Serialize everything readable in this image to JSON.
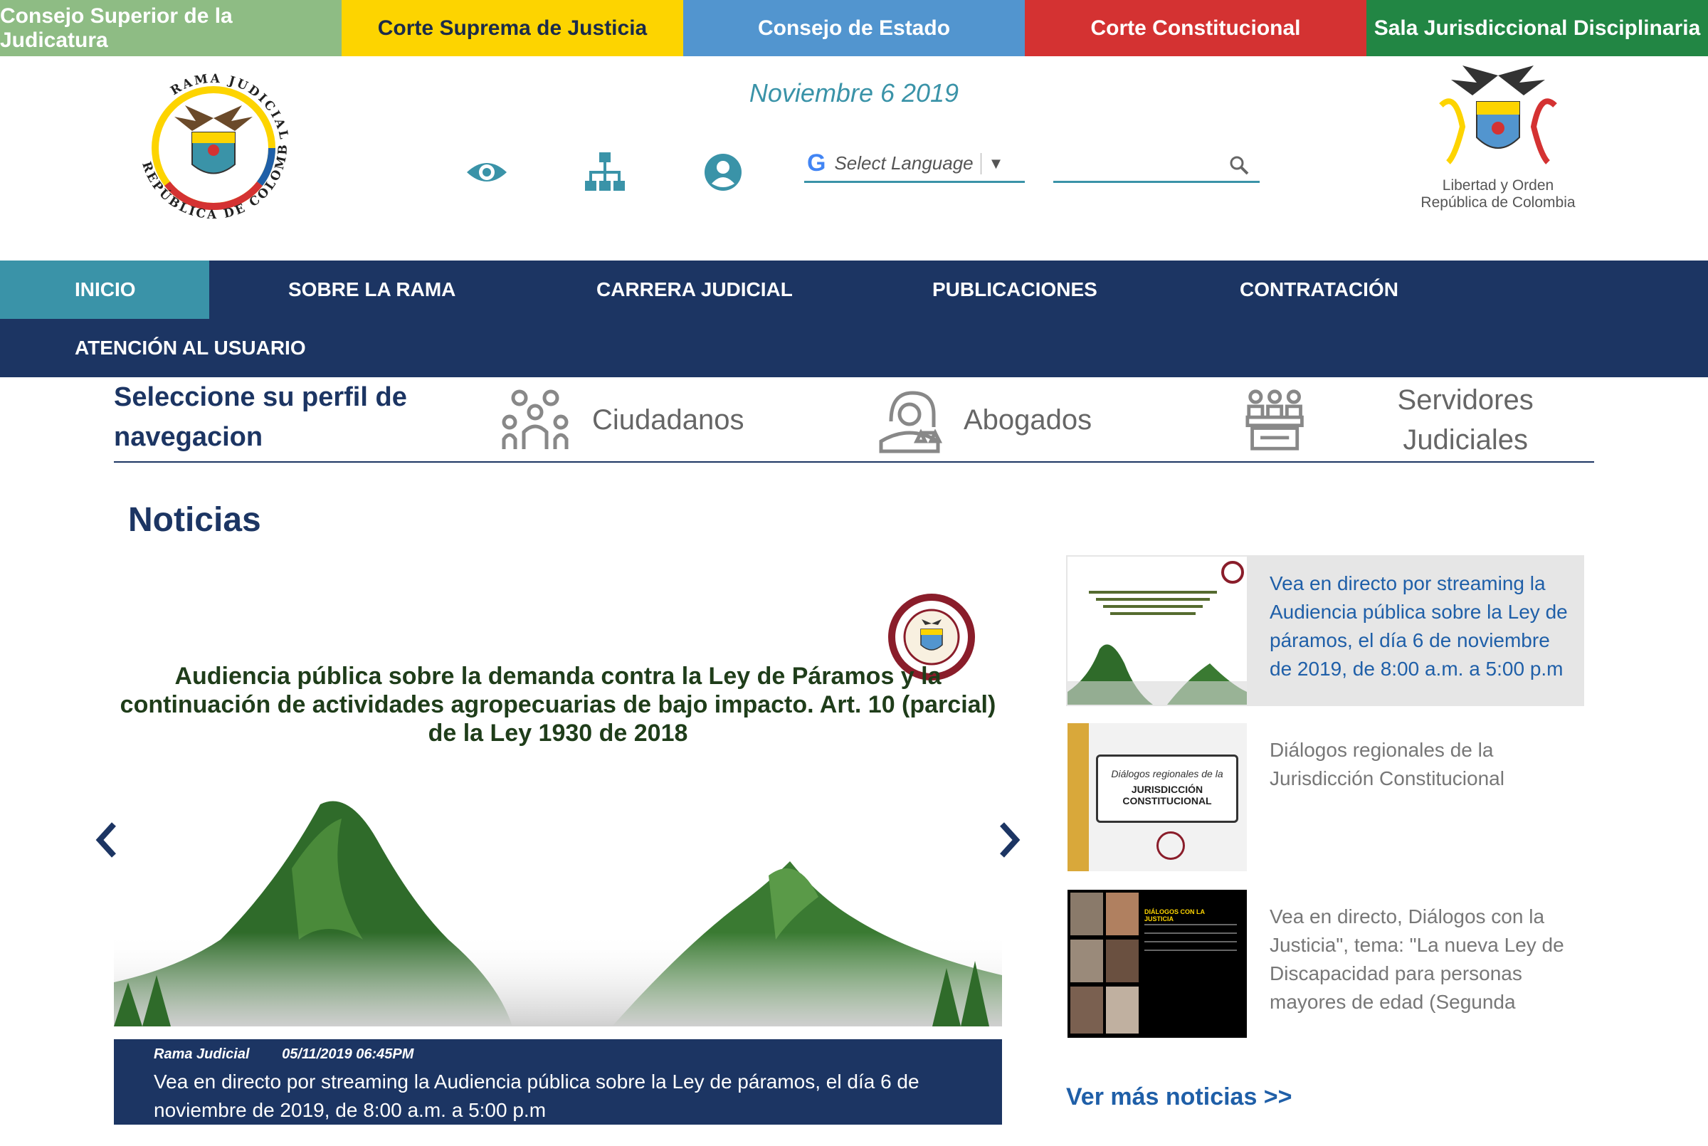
{
  "topbar": {
    "links": [
      "Consejo Superior de la Judicatura",
      "Corte Suprema de Justicia",
      "Consejo de Estado",
      "Corte Constitucional",
      "Sala Jurisdiccional Disciplinaria"
    ]
  },
  "header": {
    "date": "Noviembre 6 2019",
    "left_logo_text": "RAMA JUDICIAL · REPÚBLICA DE COLOMBIA",
    "right_logo_text": [
      "Libertad y Orden",
      "República de Colombia"
    ],
    "language_label": "Select Language",
    "google_letter": "G",
    "language_arrow": "▼",
    "search_placeholder": ""
  },
  "nav": {
    "items": [
      "INICIO",
      "SOBRE LA RAMA",
      "CARRERA JUDICIAL",
      "PUBLICACIONES",
      "CONTRATACIÓN",
      "ATENCIÓN AL USUARIO"
    ]
  },
  "profile": {
    "title": "Seleccione su perfil de navegacion",
    "options": [
      "Ciudadanos",
      "Abogados",
      "Servidores Judiciales"
    ]
  },
  "news": {
    "title": "Noticias",
    "slide_text": "Audiencia pública sobre la demanda contra la Ley de Páramos y la continuación de actividades agropecuarias de bajo impacto. Art. 10 (parcial) de la Ley 1930 de 2018",
    "caption_source": "Rama Judicial",
    "caption_date": "05/11/2019 06:45PM",
    "caption_text": "Vea en directo por streaming la Audiencia pública sobre la Ley de páramos, el día 6 de noviembre de 2019, de 8:00 a.m. a 5:00 p.m",
    "side": [
      "Vea en directo por streaming la Audiencia pública sobre la Ley de páramos, el día 6 de noviembre de 2019, de 8:00 a.m. a 5:00 p.m",
      "Diálogos regionales de la Jurisdicción Constitucional",
      "Vea en directo, Diálogos con la Justicia\", tema: \"La nueva Ley de Discapacidad para personas mayores de edad (Segunda"
    ],
    "thumb2_text": [
      "Diálogos regionales de la",
      "JURISDICCIÓN CONSTITUCIONAL"
    ],
    "thumb3_text": "DIÁLOGOS CON LA JUSTICIA",
    "more": "Ver más noticias >>"
  },
  "colors": {
    "navy": "#1c3563",
    "teal": "#3a93a8",
    "link_blue": "#1f5fa8"
  }
}
